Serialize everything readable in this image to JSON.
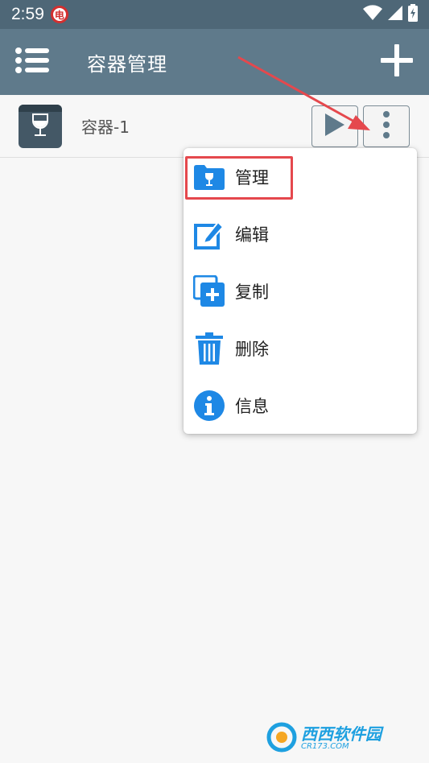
{
  "status_bar": {
    "time": "2:59",
    "app_icon_glyph": "电"
  },
  "app_bar": {
    "title": "容器管理"
  },
  "containers": [
    {
      "name": "容器-1"
    }
  ],
  "popup_menu": {
    "items": [
      {
        "label": "管理",
        "icon": "folder-wine-icon"
      },
      {
        "label": "编辑",
        "icon": "edit-icon"
      },
      {
        "label": "复制",
        "icon": "copy-icon"
      },
      {
        "label": "删除",
        "icon": "trash-icon"
      },
      {
        "label": "信息",
        "icon": "info-icon"
      }
    ]
  },
  "colors": {
    "status_bar": "#4e6777",
    "app_bar": "#5f7a8b",
    "accent_blue": "#1e88e5",
    "highlight": "#e5484d"
  },
  "watermark": {
    "text": "西西软件园",
    "sub": "CR173.COM"
  }
}
